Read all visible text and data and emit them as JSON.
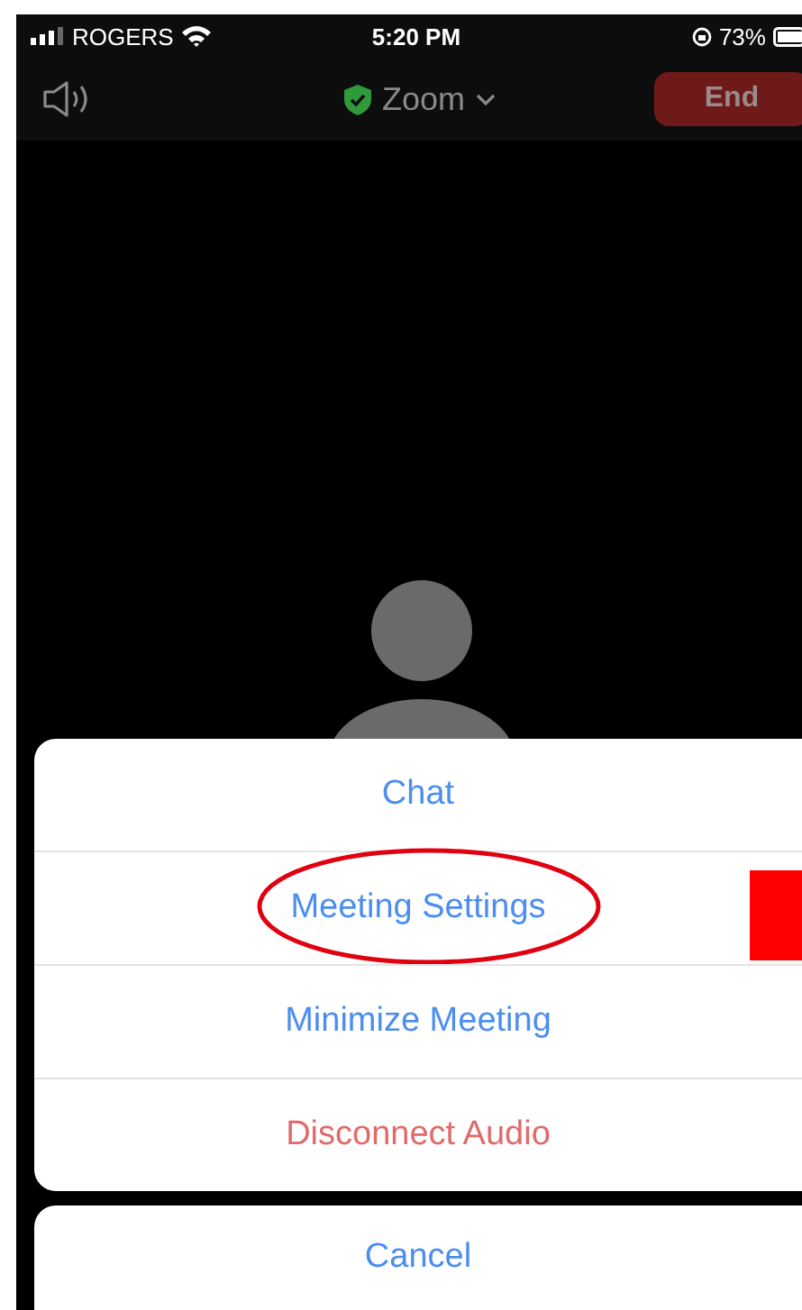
{
  "status_bar": {
    "carrier": "ROGERS",
    "time": "5:20 PM",
    "battery": "73%"
  },
  "top_bar": {
    "title": "Zoom",
    "end_button": "End"
  },
  "action_sheet": {
    "items": [
      {
        "label": "Chat",
        "kind": "default",
        "highlighted": false
      },
      {
        "label": "Meeting Settings",
        "kind": "default",
        "highlighted": true
      },
      {
        "label": "Minimize Meeting",
        "kind": "default",
        "highlighted": false
      },
      {
        "label": "Disconnect Audio",
        "kind": "destructive",
        "highlighted": false
      }
    ],
    "cancel": "Cancel"
  }
}
